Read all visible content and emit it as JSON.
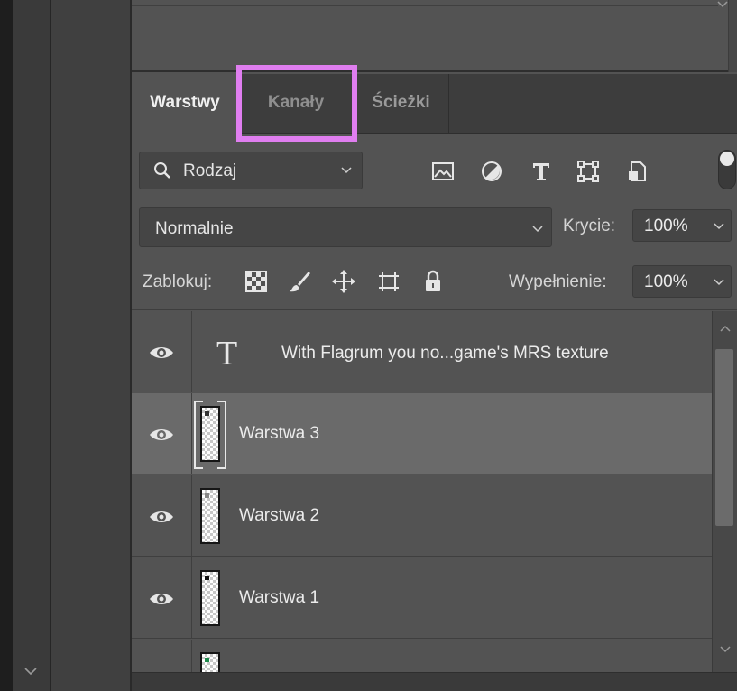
{
  "tabs": [
    {
      "label": "Warstwy",
      "active": true
    },
    {
      "label": "Kanały",
      "active": false
    },
    {
      "label": "Ścieżki",
      "active": false
    }
  ],
  "filter": {
    "label": "Rodzaj"
  },
  "filter_icons": [
    "image-filter-icon",
    "adjustment-filter-icon",
    "type-filter-icon",
    "shape-filter-icon",
    "smart-object-filter-icon"
  ],
  "blend": {
    "mode": "Normalnie",
    "opacity_label": "Krycie:",
    "opacity_value": "100%"
  },
  "lock": {
    "label": "Zablokuj:",
    "fill_label": "Wypełnienie:",
    "fill_value": "100%"
  },
  "lock_icons": [
    "lock-transparent-pixels-icon",
    "lock-image-pixels-icon",
    "lock-position-icon",
    "lock-artboard-icon",
    "lock-all-icon"
  ],
  "layers": [
    {
      "name": "With Flagrum you no...game's  MRS texture",
      "type": "text",
      "visible": true,
      "selected": false
    },
    {
      "name": "Warstwa 3",
      "type": "pixel",
      "visible": true,
      "selected": true
    },
    {
      "name": "Warstwa 2",
      "type": "pixel",
      "visible": true,
      "selected": false
    },
    {
      "name": "Warstwa 1",
      "type": "pixel",
      "visible": true,
      "selected": false
    }
  ],
  "colors": {
    "highlight": "#e07ef0",
    "panel": "#535353",
    "selected_row": "#6a6a6a"
  }
}
